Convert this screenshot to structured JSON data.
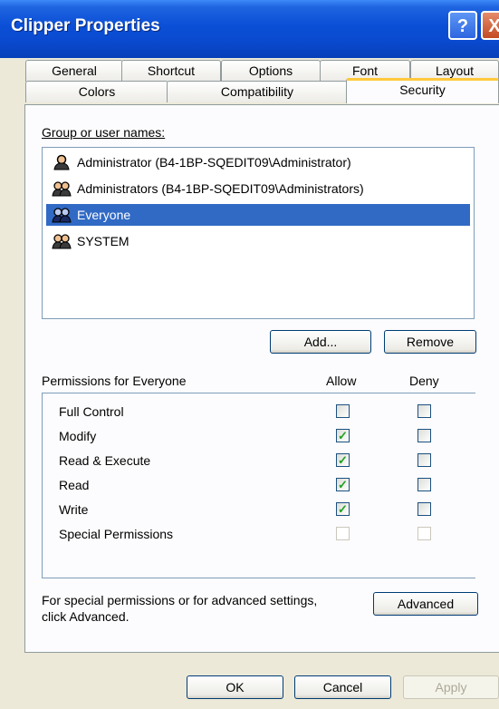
{
  "window": {
    "title": "Clipper Properties",
    "help_glyph": "?",
    "close_glyph": "X"
  },
  "tabs_row1": [
    "General",
    "Shortcut",
    "Options",
    "Font",
    "Layout"
  ],
  "tabs_row2": [
    "Colors",
    "Compatibility",
    "Security"
  ],
  "active_tab": "Security",
  "groups": {
    "label": "Group or user names:",
    "items": [
      {
        "name": "Administrator (B4-1BP-SQEDIT09\\Administrator)",
        "icon": "single-user-icon",
        "selected": false
      },
      {
        "name": "Administrators (B4-1BP-SQEDIT09\\Administrators)",
        "icon": "group-users-icon",
        "selected": false
      },
      {
        "name": "Everyone",
        "icon": "group-users-icon",
        "selected": true
      },
      {
        "name": "SYSTEM",
        "icon": "group-users-icon",
        "selected": false
      }
    ]
  },
  "buttons": {
    "add": "Add...",
    "remove": "Remove",
    "advanced": "Advanced",
    "ok": "OK",
    "cancel": "Cancel",
    "apply": "Apply"
  },
  "permissions": {
    "label": "Permissions for Everyone",
    "allow_header": "Allow",
    "deny_header": "Deny",
    "rows": [
      {
        "name": "Full Control",
        "allow": false,
        "deny": false,
        "enabled": true
      },
      {
        "name": "Modify",
        "allow": true,
        "deny": false,
        "enabled": true
      },
      {
        "name": "Read & Execute",
        "allow": true,
        "deny": false,
        "enabled": true
      },
      {
        "name": "Read",
        "allow": true,
        "deny": false,
        "enabled": true
      },
      {
        "name": "Write",
        "allow": true,
        "deny": false,
        "enabled": true
      },
      {
        "name": "Special Permissions",
        "allow": false,
        "deny": false,
        "enabled": false
      }
    ]
  },
  "advanced_text_line1": "For special permissions or for advanced settings,",
  "advanced_text_line2": "click Advanced.",
  "colors": {
    "selection": "#316ac5",
    "check": "#21a121",
    "tab_highlight": "#ffc83c"
  }
}
